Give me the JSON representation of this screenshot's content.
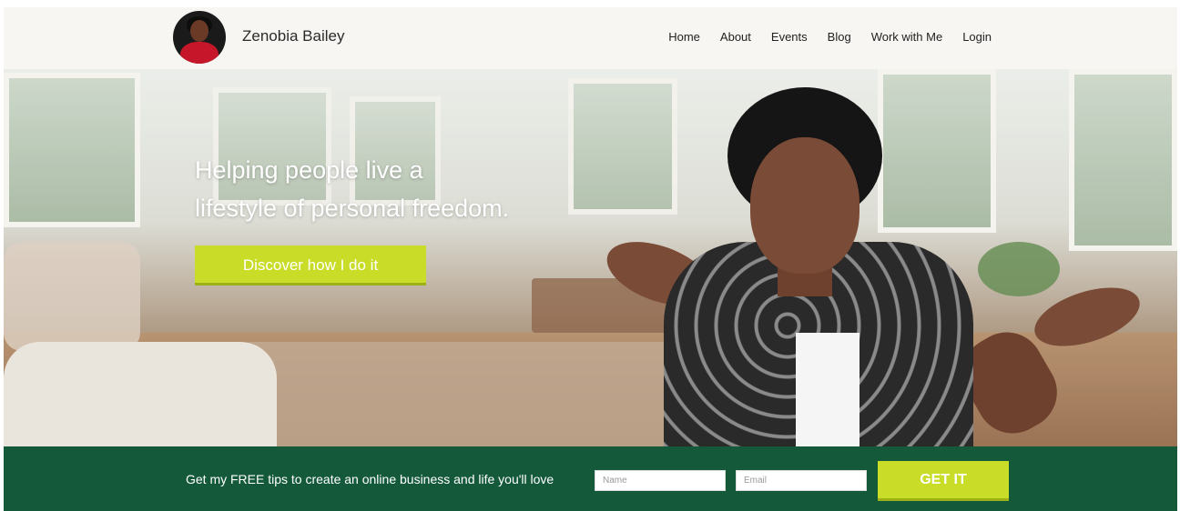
{
  "header": {
    "site_name": "Zenobia Bailey",
    "nav": [
      {
        "label": "Home"
      },
      {
        "label": "About"
      },
      {
        "label": "Events"
      },
      {
        "label": "Blog"
      },
      {
        "label": "Work with Me"
      },
      {
        "label": "Login"
      }
    ]
  },
  "hero": {
    "headline_line1": "Helping people live a",
    "headline_line2": "lifestyle of personal freedom.",
    "cta_label": "Discover how I do it"
  },
  "optin": {
    "text": "Get my FREE tips to create an online business and life you'll love",
    "name_placeholder": "Name",
    "name_value": "",
    "email_placeholder": "Email",
    "email_value": "",
    "button_label": "GET IT"
  },
  "colors": {
    "accent": "#c8dc28",
    "optin_background": "#145a3a",
    "header_background": "#f7f6f3"
  },
  "icons": {
    "avatar": "avatar-photo"
  }
}
